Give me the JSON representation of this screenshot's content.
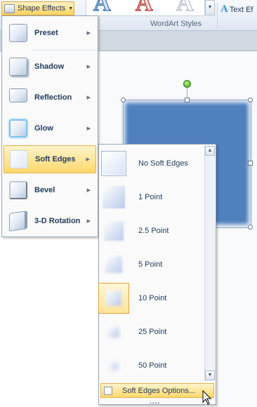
{
  "ribbon": {
    "shape_effects_label": "Shape Effects",
    "group_label": "WordArt Styles",
    "text_effects_label": "Text Ef",
    "text_effects_letter": "A",
    "wordart_letters": [
      "A",
      "A",
      "A"
    ]
  },
  "shape_effects_menu": {
    "items": [
      {
        "label": "Preset",
        "icon": "preset-icon"
      },
      {
        "label": "Shadow",
        "icon": "shadow-icon"
      },
      {
        "label": "Reflection",
        "icon": "reflection-icon"
      },
      {
        "label": "Glow",
        "icon": "glow-icon"
      },
      {
        "label": "Soft Edges",
        "icon": "soft-edges-icon",
        "active": true
      },
      {
        "label": "Bevel",
        "icon": "bevel-icon"
      },
      {
        "label": "3-D Rotation",
        "icon": "3d-rotation-icon"
      }
    ]
  },
  "soft_edges_gallery": {
    "items": [
      {
        "label": "No Soft Edges",
        "level": 0
      },
      {
        "label": "1 Point",
        "level": 1
      },
      {
        "label": "2.5 Point",
        "level": 2.5
      },
      {
        "label": "5 Point",
        "level": 5
      },
      {
        "label": "10 Point",
        "level": 10,
        "selected": true
      },
      {
        "label": "25 Point",
        "level": 25
      },
      {
        "label": "50 Point",
        "level": 50
      }
    ],
    "options_label": "Soft Edges Options..."
  },
  "colors": {
    "accent_hover": "#ffd86a",
    "shape_fill": "#4f81bd",
    "wordart_blue": "#4f81bd",
    "wordart_red": "#c0504d"
  }
}
